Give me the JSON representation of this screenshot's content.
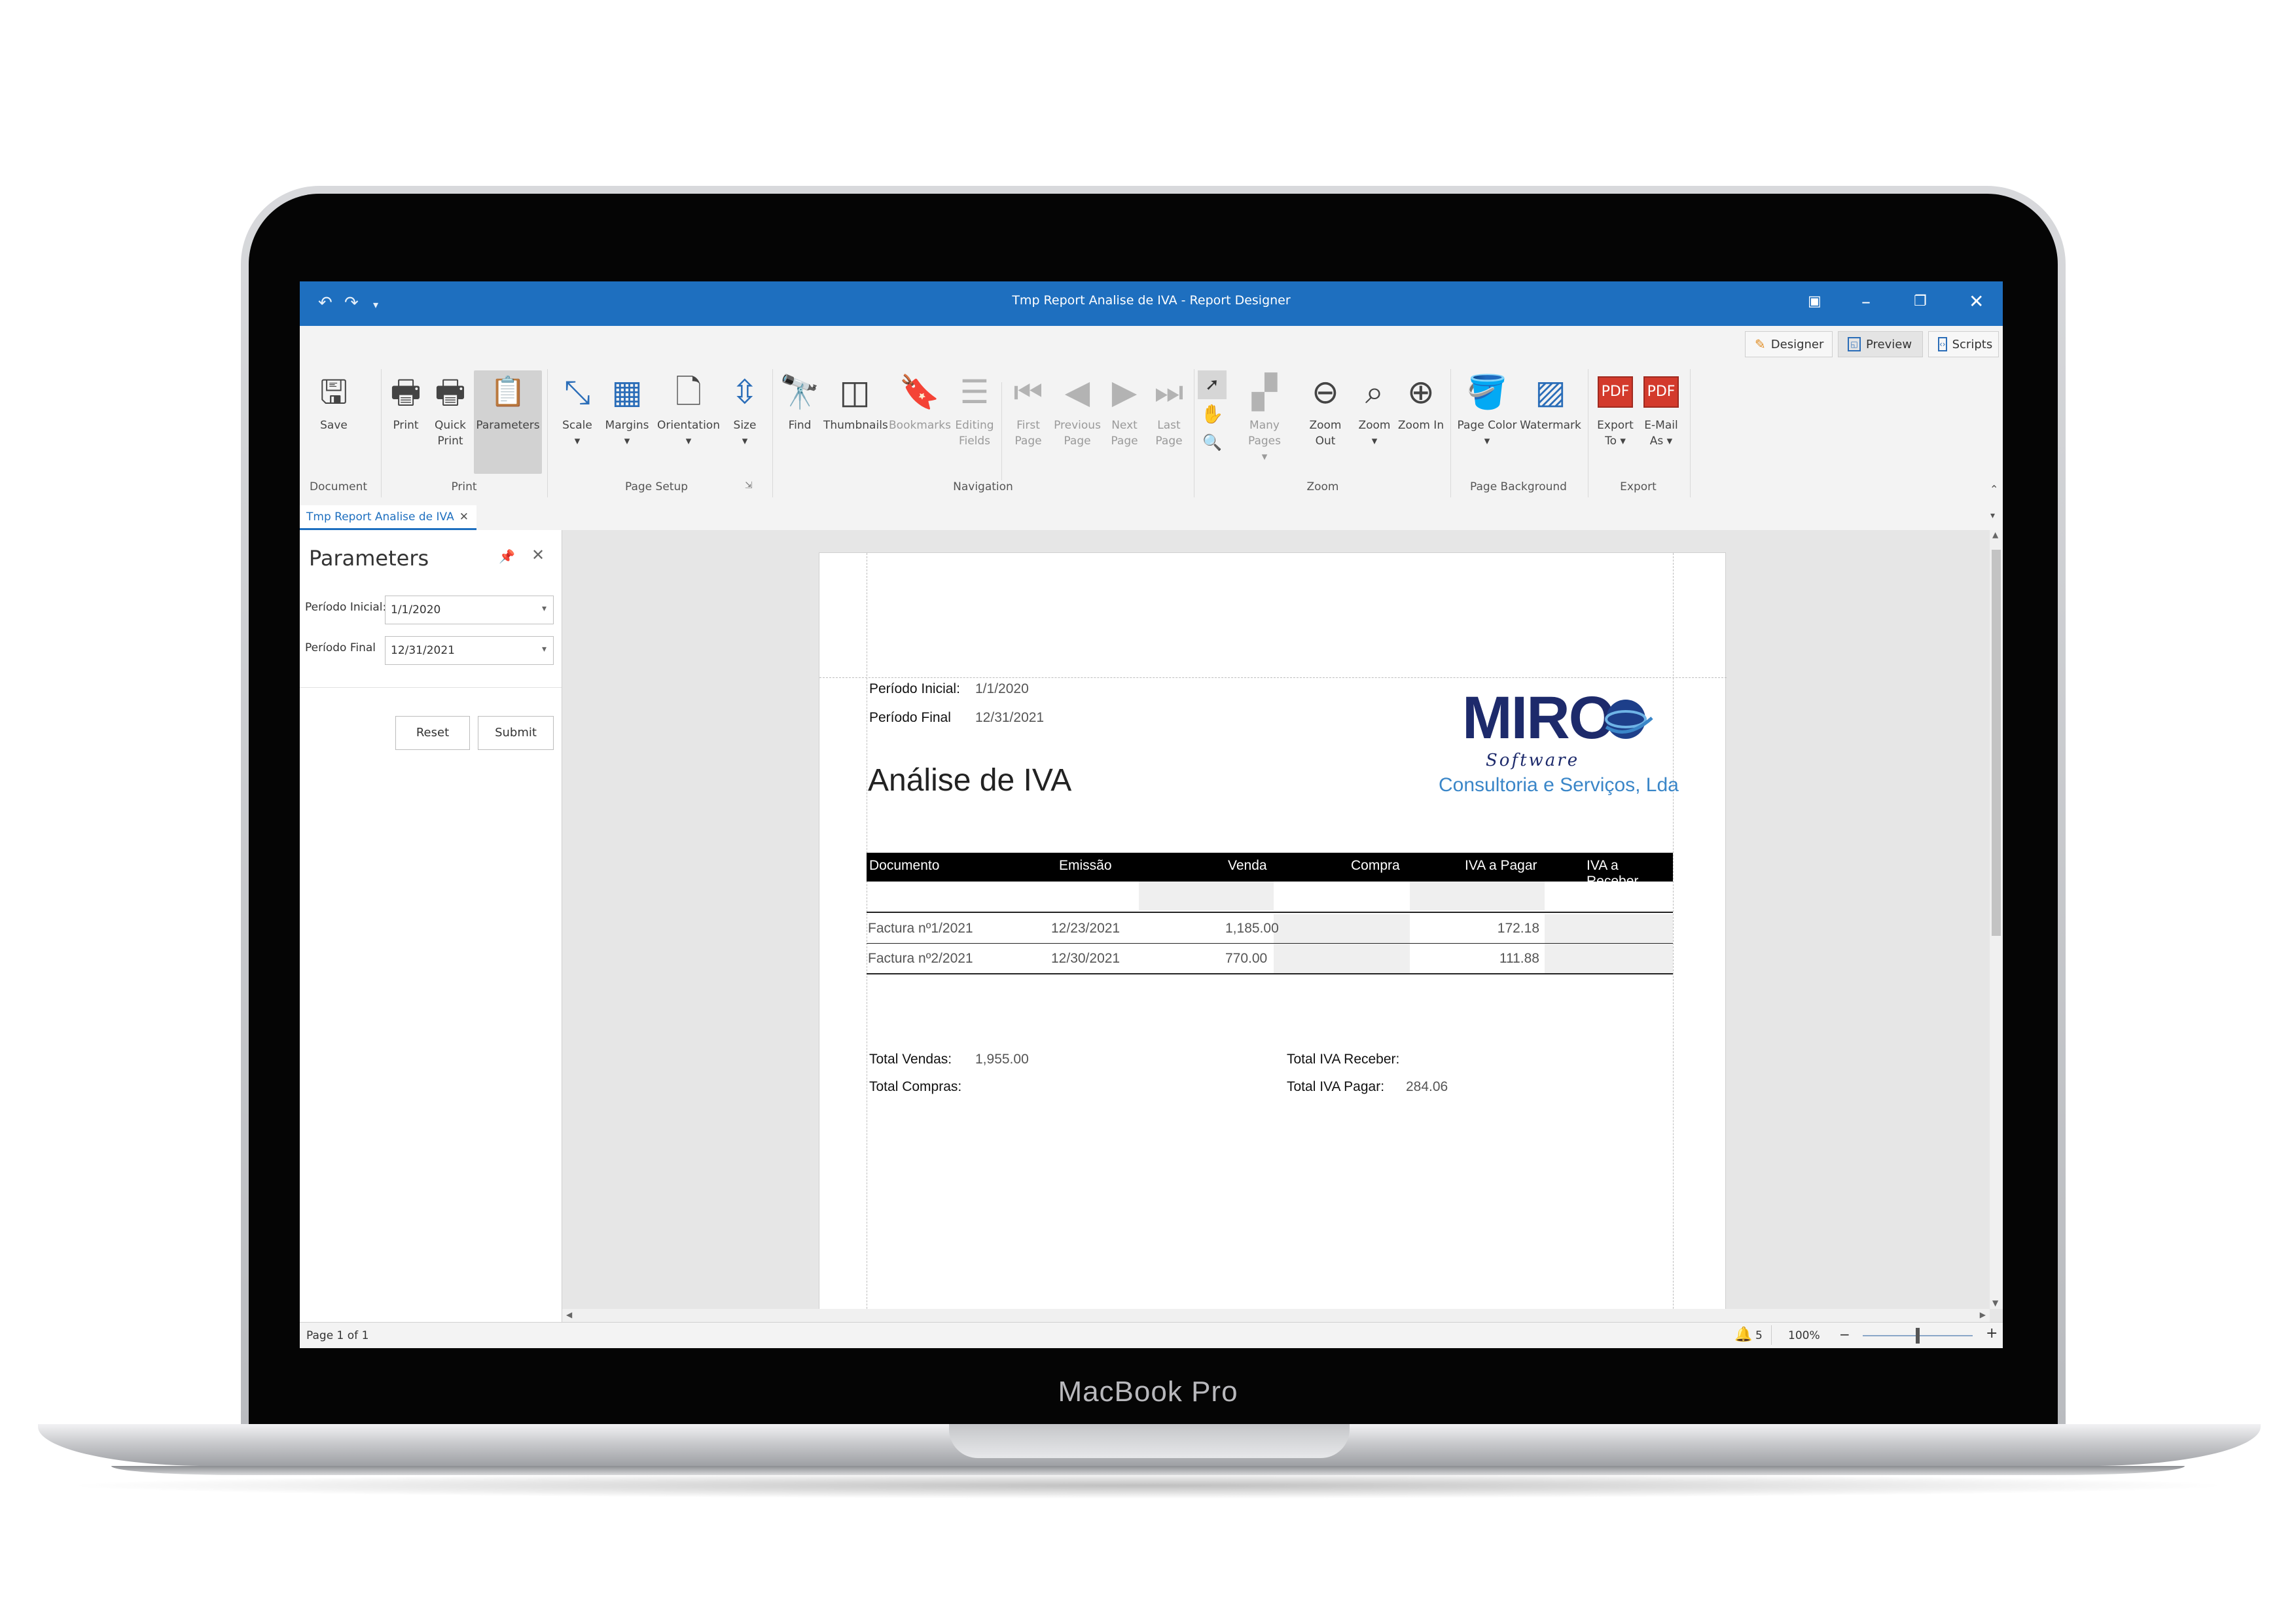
{
  "device": {
    "label": "MacBook Pro"
  },
  "window": {
    "title": "Tmp Report Analise de IVA - Report Designer",
    "quick_access": [
      "undo-icon",
      "redo-icon",
      "customize-icon"
    ],
    "controls": [
      "ribbon-display-options-icon",
      "minimize-icon",
      "restore-icon",
      "close-icon"
    ]
  },
  "view_tabs": {
    "designer": "Designer",
    "preview": "Preview",
    "scripts": "Scripts"
  },
  "ribbon": {
    "groups": {
      "document": "Document",
      "print": "Print",
      "page_setup": "Page Setup",
      "navigation": "Navigation",
      "zoom": "Zoom",
      "page_background": "Page Background",
      "export": "Export"
    },
    "buttons": {
      "save": "Save",
      "print": "Print",
      "quick_print": "Quick Print",
      "parameters": "Parameters",
      "scale": "Scale",
      "margins": "Margins",
      "orientation": "Orientation",
      "size": "Size",
      "find": "Find",
      "thumbnails": "Thumbnails",
      "bookmarks": "Bookmarks",
      "editing_fields": "Editing Fields",
      "first_page": "First Page",
      "previous_page": "Previous Page",
      "next_page": "Next Page",
      "last_page": "Last Page",
      "many_pages": "Many Pages",
      "zoom_out": "Zoom Out",
      "zoom": "Zoom",
      "zoom_in": "Zoom In",
      "page_color": "Page Color",
      "watermark": "Watermark",
      "export_to": "Export To",
      "email_as": "E-Mail As"
    }
  },
  "document_tab": {
    "label": "Tmp Report Analise de IVA"
  },
  "parameters_panel": {
    "title": "Parameters",
    "fields": [
      {
        "label": "Período Inicial:",
        "value": "1/1/2020"
      },
      {
        "label": "Período Final",
        "value": "12/31/2021"
      }
    ],
    "reset": "Reset",
    "submit": "Submit"
  },
  "report": {
    "periodo_inicial_label": "Período Inicial:",
    "periodo_inicial_value": "1/1/2020",
    "periodo_final_label": "Período Final",
    "periodo_final_value": "12/31/2021",
    "title": "Análise de IVA",
    "logo": {
      "main": "MIRO",
      "software": "Software",
      "subtitle": "Consultoria e Serviços, Lda"
    },
    "columns": [
      "Documento",
      "Emissão",
      "Venda",
      "Compra",
      "IVA a Pagar",
      "IVA a Receber"
    ],
    "rows": [
      {
        "documento": "Factura nº1/2021",
        "emissao": "12/23/2021",
        "venda": "1,185.00",
        "compra": "",
        "iva_pagar": "172.18",
        "iva_receber": ""
      },
      {
        "documento": "Factura nº2/2021",
        "emissao": "12/30/2021",
        "venda": "770.00",
        "compra": "",
        "iva_pagar": "111.88",
        "iva_receber": ""
      }
    ],
    "totals": {
      "total_vendas_label": "Total Vendas:",
      "total_vendas_value": "1,955.00",
      "total_compras_label": "Total Compras:",
      "total_compras_value": "",
      "total_iva_receber_label": "Total IVA Receber:",
      "total_iva_receber_value": "",
      "total_iva_pagar_label": "Total IVA Pagar:",
      "total_iva_pagar_value": "284.06"
    }
  },
  "status_bar": {
    "page": "Page 1 of 1",
    "notifications": "5",
    "zoom": "100%",
    "zoom_fraction": 0.5
  },
  "colors": {
    "accent": "#1e6fbf",
    "logo_dark": "#1d2a6b",
    "logo_light": "#3a86c8",
    "pdf_red": "#d33a2c"
  }
}
